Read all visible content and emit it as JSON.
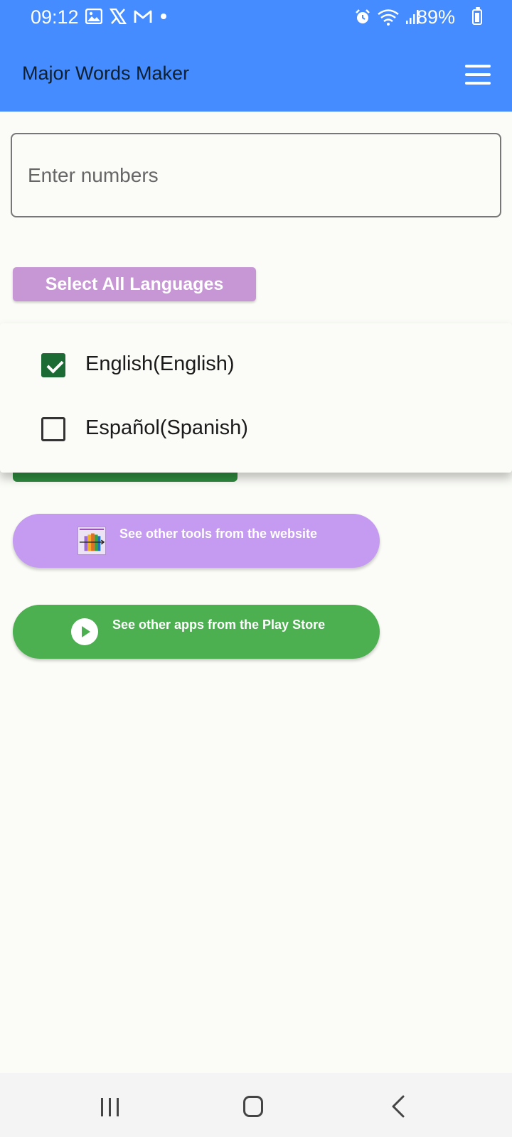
{
  "status_bar": {
    "time": "09:12",
    "battery_percent": "89%",
    "left_icons": [
      "gallery-icon",
      "x-icon",
      "gmail-icon",
      "dot-icon"
    ],
    "right_icons": [
      "alarm-icon",
      "wifi-icon",
      "signal-icon",
      "battery-icon"
    ]
  },
  "app_bar": {
    "title": "Major Words Maker",
    "menu_icon": "hamburger-menu-icon",
    "background_color": "#448cff"
  },
  "numbers_input": {
    "value": "",
    "placeholder": "Enter numbers"
  },
  "select_all_button": {
    "label": "Select All Languages",
    "color": "#c697d4"
  },
  "language_dropdown": {
    "options": [
      {
        "label": "English(English)",
        "checked": true
      },
      {
        "label": "Español(Spanish)",
        "checked": false
      }
    ],
    "check_color": "#1c6b34"
  },
  "buttons": {
    "website": {
      "label": "See other tools from the website",
      "icon": "tools-icon",
      "color": "#c49bf0"
    },
    "playstore": {
      "label": "See other apps from the Play Store",
      "icon": "play-icon",
      "color": "#4caf50"
    }
  },
  "nav_bar": {
    "buttons": [
      "recent-apps-icon",
      "home-icon",
      "back-icon"
    ]
  }
}
